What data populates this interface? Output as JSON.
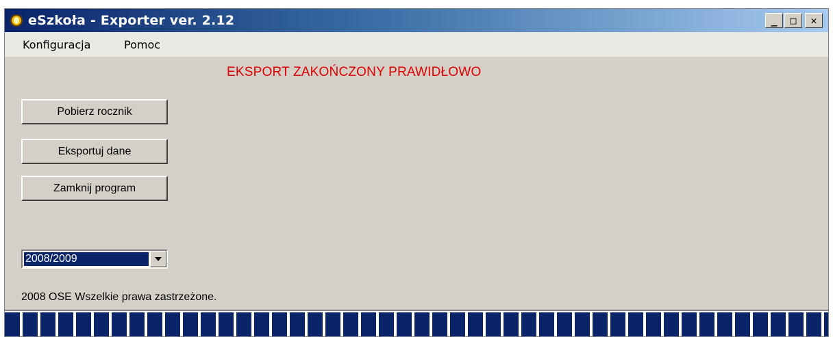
{
  "window": {
    "title": "eSzkoła - Exporter ver. 2.12",
    "icon": "app-logo-icon",
    "controls": {
      "minimize": "_",
      "maximize": "□",
      "close": "✕"
    }
  },
  "menu": {
    "items": [
      {
        "label": "Konfiguracja"
      },
      {
        "label": "Pomoc"
      }
    ]
  },
  "status": {
    "message": "EKSPORT ZAKOŃCZONY PRAWIDŁOWO",
    "color": "#e00000"
  },
  "buttons": {
    "fetch_label": "Pobierz rocznik",
    "export_label": "Eksportuj dane",
    "close_label": "Zamknij program"
  },
  "year_select": {
    "selected": "2008/2009"
  },
  "footer": {
    "copyright": "2008 OSE Wszelkie prawa zastrzeżone."
  },
  "progress": {
    "fraction": 1.0,
    "color": "#0a246a"
  }
}
